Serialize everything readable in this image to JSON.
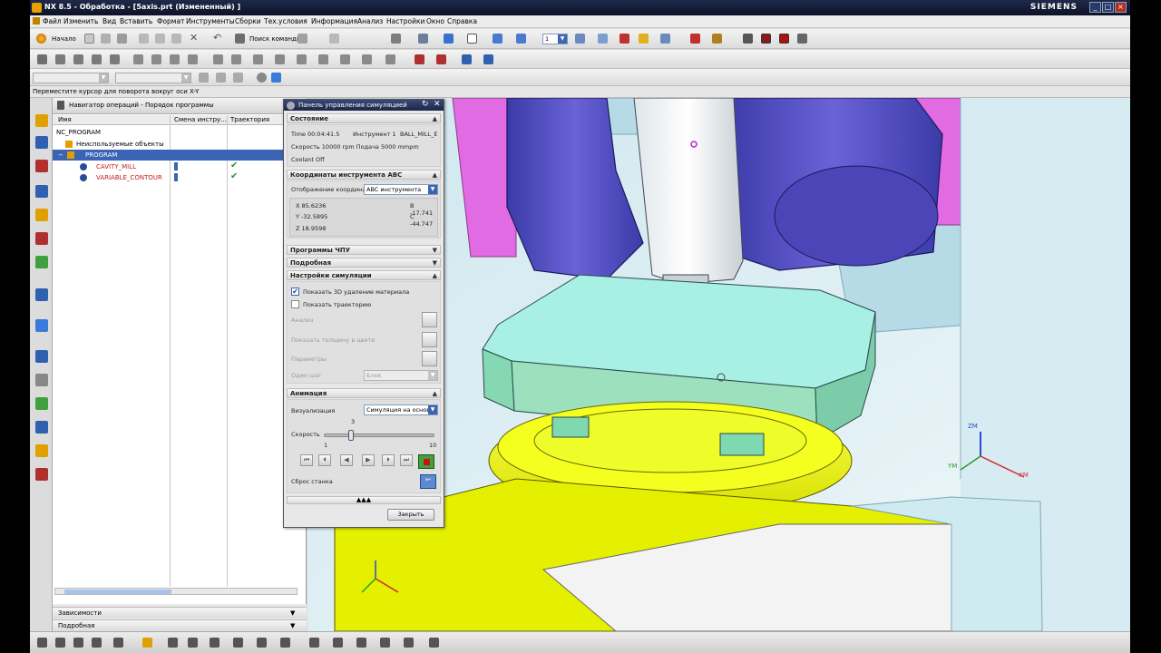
{
  "window": {
    "title": "NX 8.5 - Обработка - [5axis.prt (Измененный) ]",
    "brand": "SIEMENS"
  },
  "menu": [
    "Файл",
    "Изменить",
    "Вид",
    "Вставить",
    "Формат",
    "Инструменты",
    "Сборки",
    "Тех.условия",
    "Информация",
    "Анализ",
    "Настройки",
    "Окно",
    "Справка"
  ],
  "toolbar": {
    "start_label": "Начало",
    "command_search_label": "Поиск команды",
    "layer_value": "1"
  },
  "status_line": "Переместите курсор для поворота вокруг оси X-Y",
  "navigator": {
    "title": "Навигатор операций - Порядок программы",
    "columns": [
      "Имя",
      "Смена инстру...",
      "Траектория"
    ],
    "rows": [
      "NC_PROGRAM",
      "Неиспользуемые объекты",
      "PROGRAM",
      "CAVITY_MILL",
      "VARIABLE_CONTOUR"
    ],
    "bottom_sections": [
      "Зависимости",
      "Подробная"
    ]
  },
  "sim_panel": {
    "title": "Панель управления симуляцией",
    "state_header": "Состояние",
    "time": "Time 00:04:41.5",
    "tool": "Инструмент 1",
    "tool_name": "BALL_MILL_E",
    "speed_feed": "Скорость 10000 rpm Подача 5000 mmpm",
    "coolant": "Coolant Off",
    "coords_header": "Координаты инструмента ABC",
    "coords_display_label": "Отображение координа",
    "coords_display_value": "ABC инструмента",
    "x": "X 85.6236",
    "y": "Y -32.5895",
    "z": "Z 18.9598",
    "b": "B -17.741",
    "c": "C -44.747",
    "cnc_programs": "Программы ЧПУ",
    "detailed": "Подробная",
    "sim_settings": "Настройки симуляции",
    "show_3d_removal": "Показать 3D удаление материала",
    "show_path": "Показать траекторию",
    "analysis": "Анализ",
    "show_thickness": "Показать толщину в цвете",
    "parameters": "Параметры",
    "step_label": "Один шаг",
    "step_value": "Блок",
    "animation_header": "Анимация",
    "visualization_label": "Визуализация",
    "visualization_value": "Симуляция на основе",
    "speed_label": "Скорость",
    "speed_value": "3",
    "speed_min": "1",
    "speed_max": "10",
    "speed_fraction": 0.22,
    "reset_machine": "Сброс станка",
    "close_button": "Закрыть"
  },
  "viewport": {
    "axis_z": "ZM",
    "axis_y": "YM",
    "axis_x": "XM"
  },
  "colors": {
    "accent": "#3c64b4",
    "machine_head": "#5d55c9",
    "workpiece": "#a8f0e4",
    "table": "#e9f000"
  }
}
